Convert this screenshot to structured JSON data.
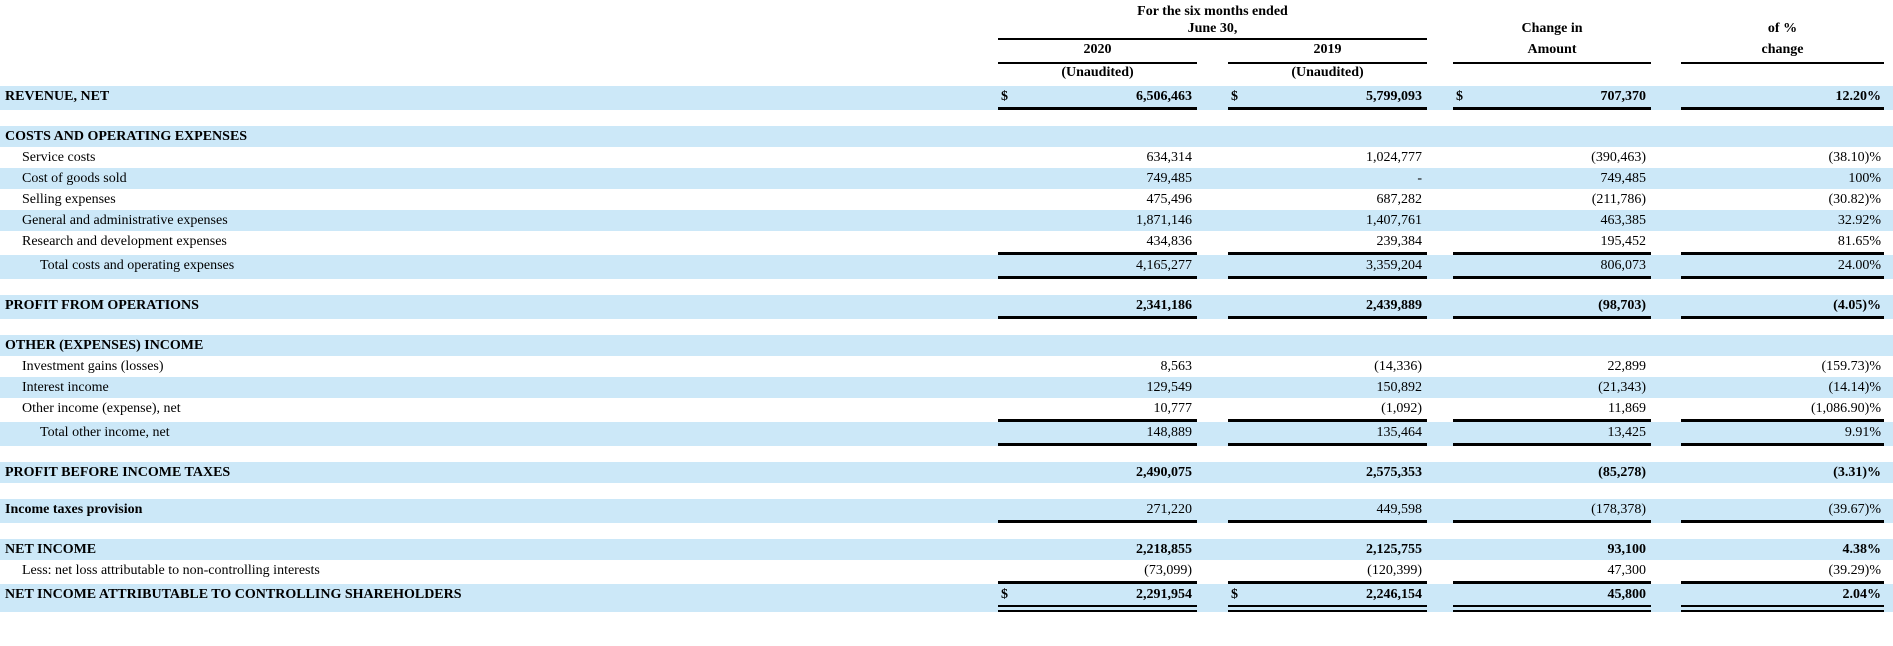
{
  "document": {
    "kind": "income-statement-comparison-table",
    "currency_symbol": "$"
  },
  "colors": {
    "row_highlight": "#cce8f8",
    "row_plain": "#ffffff",
    "rule": "#000000",
    "text": "#000000"
  },
  "table": {
    "header": {
      "period_line1": "For the six months ended",
      "period_line2": "June 30,",
      "col_2020": {
        "year": "2020",
        "note": "(Unaudited)"
      },
      "col_2019": {
        "year": "2019",
        "note": "(Unaudited)"
      },
      "col_change": {
        "line1": "Change in",
        "line2": "Amount"
      },
      "col_pct": {
        "line1": "of %",
        "line2": "change"
      }
    },
    "rows": [
      {
        "kind": "data",
        "label": "REVENUE, NET",
        "indent": 0,
        "bold_label": true,
        "bold_values": true,
        "bg": "highlight",
        "dollars": [
          true,
          true,
          true,
          false
        ],
        "values": [
          "6,506,463",
          "5,799,093",
          "707,370",
          "12.20%"
        ],
        "rule": "single"
      },
      {
        "kind": "spacer",
        "bg": "plain"
      },
      {
        "kind": "section",
        "label": "COSTS AND OPERATING EXPENSES",
        "bold_label": true,
        "bg": "highlight"
      },
      {
        "kind": "data",
        "label": "Service costs",
        "indent": 1,
        "bg": "plain",
        "values": [
          "634,314",
          "1,024,777",
          "(390,463)",
          "(38.10)%"
        ]
      },
      {
        "kind": "data",
        "label": "Cost of goods sold",
        "indent": 1,
        "bg": "highlight",
        "values": [
          "749,485",
          "-",
          "749,485",
          "100%"
        ]
      },
      {
        "kind": "data",
        "label": "Selling expenses",
        "indent": 1,
        "bg": "plain",
        "values": [
          "475,496",
          "687,282",
          "(211,786)",
          "(30.82)%"
        ]
      },
      {
        "kind": "data",
        "label": "General and administrative expenses",
        "indent": 1,
        "bg": "highlight",
        "values": [
          "1,871,146",
          "1,407,761",
          "463,385",
          "32.92%"
        ]
      },
      {
        "kind": "data",
        "label": "Research and development expenses",
        "indent": 1,
        "bg": "plain",
        "values": [
          "434,836",
          "239,384",
          "195,452",
          "81.65%"
        ],
        "rule": "single"
      },
      {
        "kind": "data",
        "label": "Total costs and operating expenses",
        "indent": 2,
        "bg": "highlight",
        "values": [
          "4,165,277",
          "3,359,204",
          "806,073",
          "24.00%"
        ],
        "rule": "single"
      },
      {
        "kind": "spacer",
        "bg": "plain"
      },
      {
        "kind": "data",
        "label": "PROFIT FROM OPERATIONS",
        "indent": 0,
        "bold_label": true,
        "bold_values": true,
        "bg": "highlight",
        "values": [
          "2,341,186",
          "2,439,889",
          "(98,703)",
          "(4.05)%"
        ],
        "rule": "single"
      },
      {
        "kind": "spacer",
        "bg": "plain"
      },
      {
        "kind": "section",
        "label": "OTHER (EXPENSES) INCOME",
        "bold_label": true,
        "bg": "highlight"
      },
      {
        "kind": "data",
        "label": "Investment gains (losses)",
        "indent": 1,
        "bg": "plain",
        "values": [
          "8,563",
          "(14,336)",
          "22,899",
          "(159.73)%"
        ]
      },
      {
        "kind": "data",
        "label": "Interest income",
        "indent": 1,
        "bg": "highlight",
        "values": [
          "129,549",
          "150,892",
          "(21,343)",
          "(14.14)%"
        ]
      },
      {
        "kind": "data",
        "label": "Other income (expense), net",
        "indent": 1,
        "bg": "plain",
        "values": [
          "10,777",
          "(1,092)",
          "11,869",
          "(1,086.90)%"
        ],
        "rule": "single"
      },
      {
        "kind": "data",
        "label": "Total other income, net",
        "indent": 2,
        "bg": "highlight",
        "values": [
          "148,889",
          "135,464",
          "13,425",
          "9.91%"
        ],
        "rule": "single"
      },
      {
        "kind": "spacer",
        "bg": "plain"
      },
      {
        "kind": "data",
        "label": "PROFIT BEFORE INCOME TAXES",
        "indent": 0,
        "bold_label": true,
        "bold_values": true,
        "bg": "highlight",
        "values": [
          "2,490,075",
          "2,575,353",
          "(85,278)",
          "(3.31)%"
        ]
      },
      {
        "kind": "spacer",
        "bg": "plain"
      },
      {
        "kind": "data",
        "label": "Income taxes provision",
        "indent": 0,
        "bold_label": true,
        "bg": "highlight",
        "values": [
          "271,220",
          "449,598",
          "(178,378)",
          "(39.67)%"
        ],
        "rule": "single"
      },
      {
        "kind": "spacer",
        "bg": "plain"
      },
      {
        "kind": "data",
        "label": "NET INCOME",
        "indent": 0,
        "bold_label": true,
        "bold_values": true,
        "bg": "highlight",
        "values": [
          "2,218,855",
          "2,125,755",
          "93,100",
          "4.38%"
        ]
      },
      {
        "kind": "data",
        "label": "Less: net loss attributable to non-controlling interests",
        "indent": 1,
        "bg": "plain",
        "values": [
          "(73,099)",
          "(120,399)",
          "47,300",
          "(39.29)%"
        ],
        "rule": "single"
      },
      {
        "kind": "data",
        "label": "NET INCOME ATTRIBUTABLE TO CONTROLLING SHAREHOLDERS",
        "indent": 0,
        "bold_label": true,
        "bold_values": true,
        "bg": "highlight",
        "dollars": [
          true,
          true,
          false,
          false
        ],
        "values": [
          "2,291,954",
          "2,246,154",
          "45,800",
          "2.04%"
        ],
        "rule": "double"
      }
    ]
  }
}
